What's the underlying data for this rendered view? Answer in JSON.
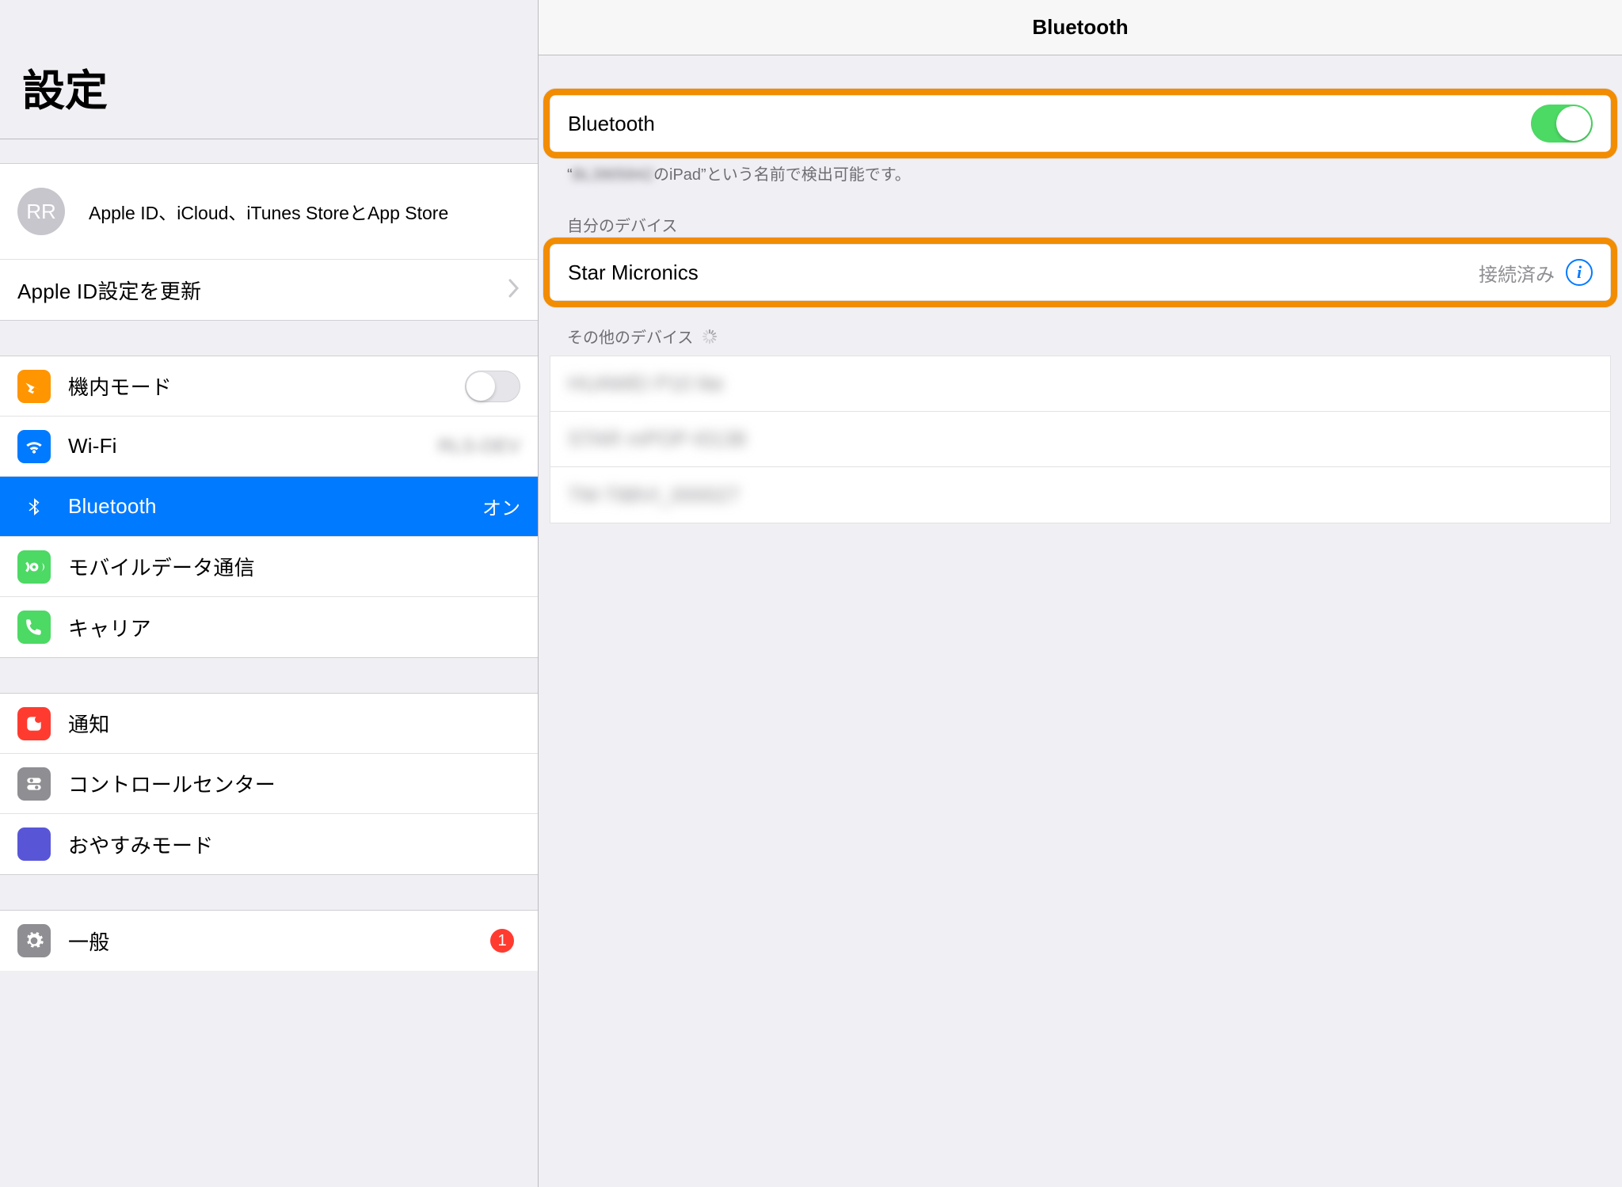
{
  "colors": {
    "accent": "#007aff",
    "highlight": "#f28c00"
  },
  "sidebar": {
    "title": "設定",
    "profile": {
      "initials": "RR",
      "subtitle": "Apple ID、iCloud、iTunes StoreとApp Store"
    },
    "apple_id_update": {
      "label": "Apple ID設定を更新"
    },
    "group1": {
      "airplane": {
        "label": "機内モード",
        "on": false
      },
      "wifi": {
        "label": "Wi-Fi",
        "value": "RLS-DEV"
      },
      "bluetooth": {
        "label": "Bluetooth",
        "value": "オン",
        "selected": true
      },
      "cellular": {
        "label": "モバイルデータ通信"
      },
      "carrier": {
        "label": "キャリア"
      }
    },
    "group2": {
      "notification": {
        "label": "通知"
      },
      "control": {
        "label": "コントロールセンター"
      },
      "dnd": {
        "label": "おやすみモード"
      }
    },
    "group3": {
      "general": {
        "label": "一般",
        "badge": "1"
      }
    }
  },
  "detail": {
    "title": "Bluetooth",
    "toggle": {
      "label": "Bluetooth",
      "on": true
    },
    "discoverable": {
      "prefix": "“",
      "blurred_name": "BL3905842",
      "suffix": "のiPad”という名前で検出可能です。"
    },
    "my_devices_header": "自分のデバイス",
    "my_device": {
      "name": "Star Micronics",
      "status": "接続済み"
    },
    "other_header": "その他のデバイス",
    "other": [
      {
        "name": "HUAWEI P10 lite"
      },
      {
        "name": "STAR mPOP-I0138"
      },
      {
        "name": "TM-T88VI_000027"
      }
    ]
  }
}
